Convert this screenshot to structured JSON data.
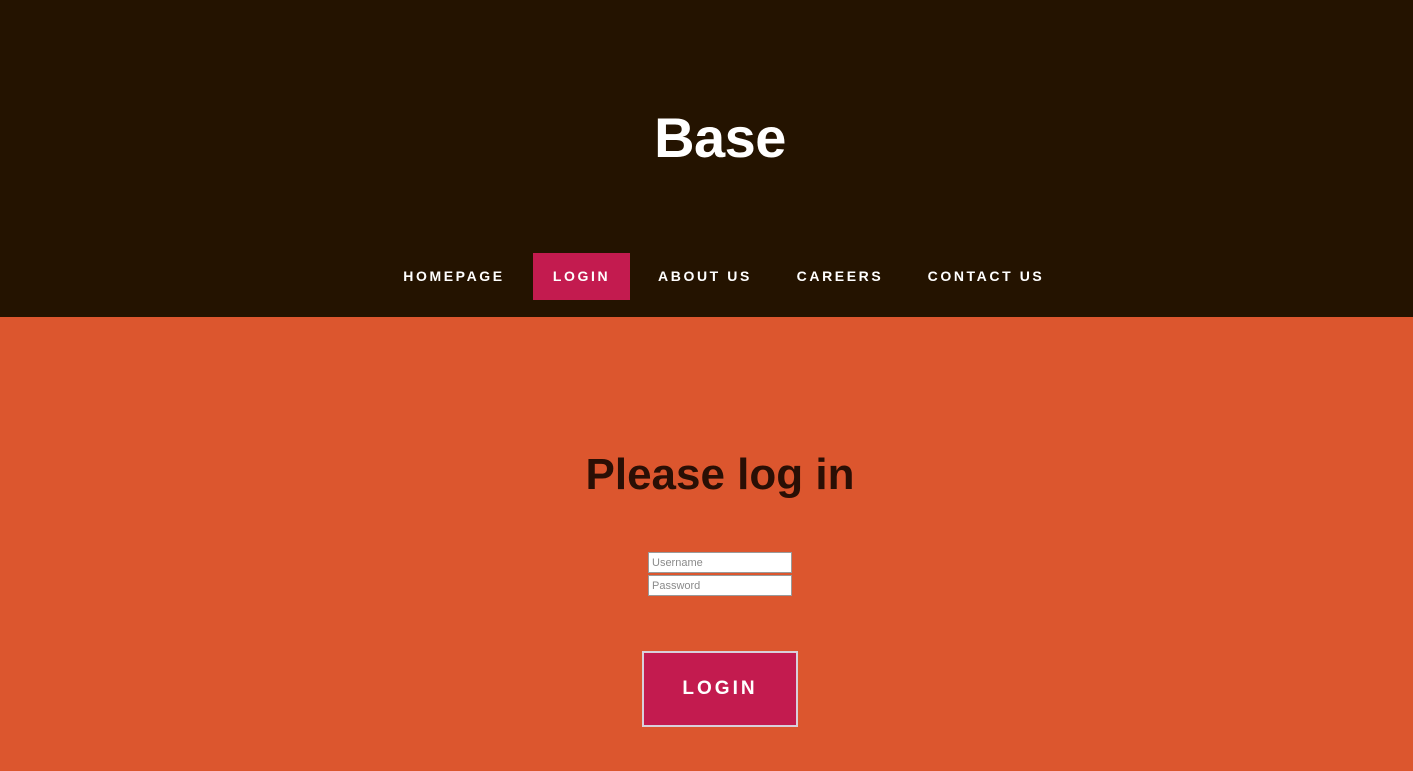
{
  "header": {
    "site_title": "Base",
    "background_color": "#241300"
  },
  "nav": {
    "items": [
      {
        "label": "HOMEPAGE",
        "active": false
      },
      {
        "label": "LOGIN",
        "active": true
      },
      {
        "label": "ABOUT US",
        "active": false
      },
      {
        "label": "CAREERS",
        "active": false
      },
      {
        "label": "CONTACT US",
        "active": false
      }
    ],
    "active_color": "#c31b4f"
  },
  "main": {
    "background_color": "#dc562e",
    "heading": "Please log in",
    "username_placeholder": "Username",
    "password_placeholder": "Password",
    "login_button_label": "LOGIN"
  }
}
